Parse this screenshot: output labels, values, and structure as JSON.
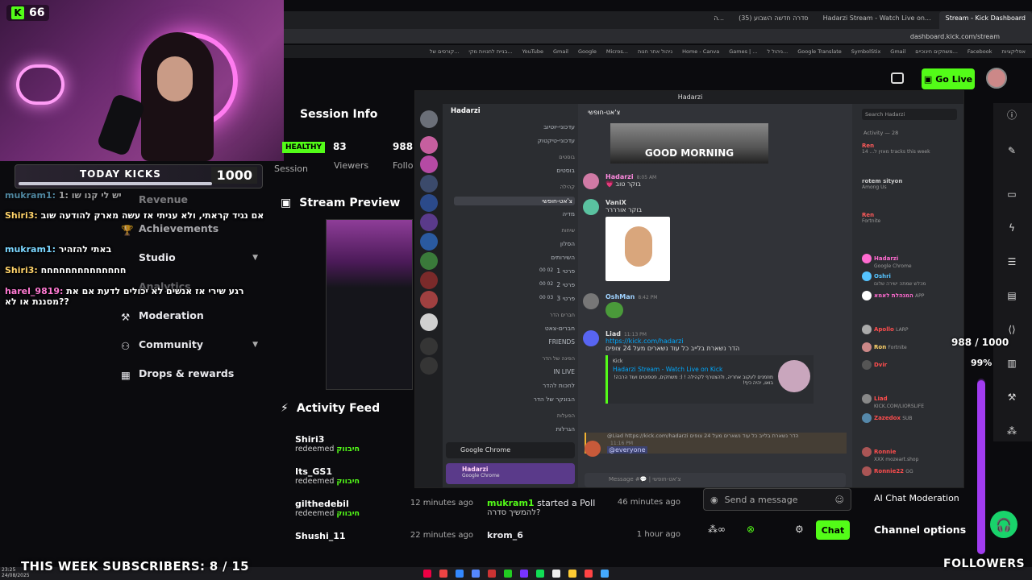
{
  "webcam": {
    "kick_count": "66",
    "today_kicks_label": "TODAY KICKS",
    "today_kicks_value": "1000"
  },
  "browser": {
    "tabs": [
      "ה...",
      "סדרה חדשה השבוע (35)",
      "Hadarzi Stream - Watch Live on...",
      "Stream - Kick Dashboard"
    ],
    "url": "dashboard.kick.com/stream",
    "bookmarks": [
      "קורסים של...",
      "בניית לחנויות מקי...",
      "YouTube",
      "Gmail",
      "Google",
      "Micros...",
      "ניהול אתר חנות",
      "Home - Canva",
      "Games | ...",
      "ניהול ל...",
      "Google Translate",
      "SymbolStix",
      "Gmail",
      "משחקים חינוכיים...",
      "Facebook",
      "אפליקציות"
    ]
  },
  "header": {
    "go_live": "Go Live"
  },
  "nav": {
    "revenue": "Revenue",
    "achievements": "Achievements",
    "studio": "Studio",
    "analytics": "Analytics",
    "moderation": "Moderation",
    "community": "Community",
    "drops": "Drops & rewards"
  },
  "chat_overlay": [
    {
      "user": "mukram1:",
      "text": "יש לי קנו שו :1"
    },
    {
      "user": "Shiri3:",
      "text": "אם נגיד קראתי, ולא עניתי אז עשה מארק להודעה שוב"
    },
    {
      "user": "mukram1:",
      "text": "באתי להזהיר"
    },
    {
      "user": "Shiri3:",
      "text": "חחחחחחחחחחחחחח"
    },
    {
      "user": "harel_9819:",
      "text": "רגע שירי אז אנשים לא יכולים לדעת אם את מסננת או לא??"
    }
  ],
  "session": {
    "title": "Session Info",
    "health": "HEALTHY",
    "viewers_value": "83",
    "viewers_label": "Viewers",
    "session_label": "Session",
    "followers_value": "988",
    "followers_label": "Follo"
  },
  "preview": {
    "title": "Stream Preview",
    "overlay_text": "THIS WEEK SUBSCRIBERS: 8 / 15"
  },
  "activity": {
    "title": "Activity Feed",
    "items": [
      {
        "name": "Shiri3",
        "action": "redeemed",
        "reward": "חיבווק",
        "time": ""
      },
      {
        "name": "Its_GS1",
        "action": "redeemed",
        "reward": "חיבווק",
        "time": ""
      },
      {
        "name": "gilthedebil",
        "action": "redeemed",
        "reward": "חיבווק",
        "time": "12 minutes ago"
      },
      {
        "name": "Shushi_11",
        "action": "",
        "reward": "",
        "time": "22 minutes ago"
      }
    ],
    "poll": {
      "name": "mukram1",
      "action": "started a Poll",
      "question": "להמשיך סדרה?",
      "time": "46 minutes ago"
    },
    "krom": {
      "name": "krom_6",
      "time": "1 hour ago"
    }
  },
  "discord": {
    "window_title": "Hadarzi",
    "guild": "Hadarzi",
    "current_channel": "צ'אט-חופשי",
    "search_placeholder": "Search Hadarzi",
    "channels": [
      {
        "name": "עדכוני-יוטיוב",
        "type": "text"
      },
      {
        "name": "עדכוני-טיקטוק",
        "type": "text"
      },
      {
        "name": "בוסטים",
        "type": "cat"
      },
      {
        "name": "בוסטים",
        "type": "text"
      },
      {
        "name": "קהילה",
        "type": "cat"
      },
      {
        "name": "צ'אט-חופשי",
        "type": "sel"
      },
      {
        "name": "מדיה",
        "type": "text"
      },
      {
        "name": "שיחות",
        "type": "cat"
      },
      {
        "name": "הסלון",
        "type": "voice"
      },
      {
        "name": "השירותים",
        "type": "voice"
      },
      {
        "name": "פרטי 1",
        "type": "voice"
      },
      {
        "name": "פרטי 2",
        "type": "voice"
      },
      {
        "name": "פרטי 3",
        "type": "voice"
      },
      {
        "name": "חברים הדר",
        "type": "cat"
      },
      {
        "name": "חברים-צאט",
        "type": "text"
      },
      {
        "name": "FRIENDS",
        "type": "text"
      },
      {
        "name": "הפינה של הדר",
        "type": "cat"
      },
      {
        "name": "IN LIVE",
        "type": "text"
      },
      {
        "name": "לחכות להדר",
        "type": "text"
      },
      {
        "name": "הבונקר של הדר",
        "type": "text"
      },
      {
        "name": "הפעלות",
        "type": "cat"
      },
      {
        "name": "הגרלות",
        "type": "text"
      }
    ],
    "voice_counts": {
      "p1": "00 02",
      "p2": "00 02",
      "p3": "00 03"
    },
    "banner_text": "GOOD MORNING",
    "messages": [
      {
        "author": "Hadarzi",
        "time": "8:05 AM",
        "text": "בוקר טוב 💗"
      },
      {
        "author": "VaniX",
        "time": "",
        "text": "בוקר אורררר"
      },
      {
        "author": "OshMan",
        "time": "8:42 PM",
        "text": ""
      },
      {
        "author": "Liad",
        "time": "11:13 PM",
        "link": "https://kick.com/hadarzi",
        "text": "הדר נשארת בלייב כל עוד נשארים מעל 24 צופים"
      },
      {
        "author": "",
        "time": "11:16 PM",
        "text": "@everyone"
      }
    ],
    "embed": {
      "site": "Kick",
      "title": "Hadarzi Stream - Watch Live on Kick",
      "desc": "מוזמנים לעקוב אחריה, ולהצטרף לקהילה ! (: משחקים, פטפוטים ועוד הרבה! בואו, יהיה כיף!"
    },
    "reply_text": "@Liad https://kick.com/hadarzi הדר נשארת בלייב כל עוד נשארים מעל 24 צופים",
    "message_placeholder": "Message #💬 | צ'אט-חופשי",
    "activity_header": "Activity — 28",
    "activity": [
      {
        "name": "Ren",
        "status": "מאזין ל... 14 tracks this week"
      },
      {
        "name": "rotem sityon",
        "status": "Among Us"
      },
      {
        "name": "Ren",
        "status": "Fortnite"
      }
    ],
    "members": [
      {
        "name": "Hadarzi",
        "sub": "Google Chrome",
        "color": "#ff6bd0"
      },
      {
        "name": "Oshri",
        "sub": "מכלש שמתה ישירה שלום",
        "color": "#55c3ff"
      },
      {
        "name": "המנהלת לאמא",
        "sub": "APP",
        "color": "#ff6bd0"
      },
      {
        "name": "Apollo",
        "sub": "LARP",
        "color": "#ff4d4d"
      },
      {
        "name": "Ron",
        "sub": "Fortnite",
        "color": "#ffd36a"
      },
      {
        "name": "Dvir",
        "sub": "",
        "color": "#ff4d4d"
      },
      {
        "name": "Liad",
        "sub": "KICK.COM/LIORSLIFE",
        "color": "#ff4d4d"
      },
      {
        "name": "Zazedox",
        "sub": "SUB",
        "color": "#ff4d4d"
      },
      {
        "name": "Ronnie",
        "sub": "XXX mozeart.shop",
        "color": "#ff4d4d"
      },
      {
        "name": "Ronnie22",
        "sub": "GG",
        "color": "#ff4d4d"
      }
    ],
    "user_panel": {
      "name": "Hadarzi",
      "status": "Google Chrome"
    },
    "chrome_popup": "Google Chrome"
  },
  "overlays": {
    "viewers_goal": "988 / 1000",
    "viewers_pct": "99%",
    "viewers_fraction": 0.99,
    "subscribers": "THIS WEEK SUBSCRIBERS: 8 / 15",
    "followers": "FOLLOWERS"
  },
  "chat": {
    "placeholder": "Send a message",
    "send": "Chat",
    "ai_moderation": "AI Chat Moderation",
    "channel_options": "Channel options"
  },
  "clock": {
    "time": "23:25",
    "date": "24/08/2025"
  }
}
